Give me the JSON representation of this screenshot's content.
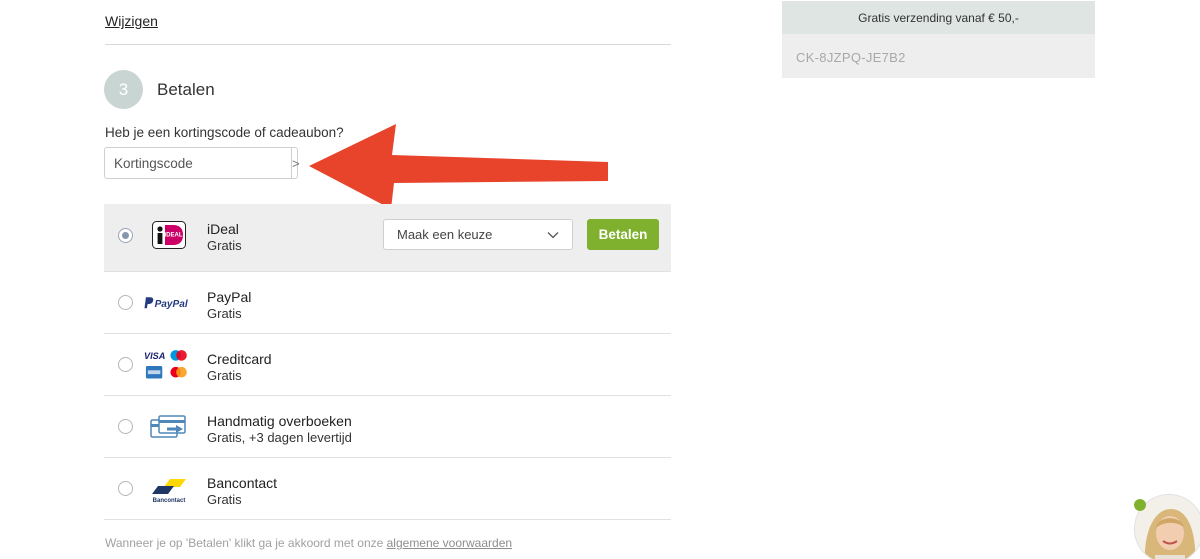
{
  "header": {
    "edit_link": "Wijzigen"
  },
  "step": {
    "number": "3",
    "title": "Betalen"
  },
  "discount": {
    "question": "Heb je een kortingscode of cadeaubon?",
    "placeholder": "Kortingscode",
    "submit_glyph": ">"
  },
  "payment_methods": [
    {
      "name": "iDeal",
      "sub": "Gratis",
      "selected": true,
      "icon": "ideal-logo",
      "bank_select": "Maak een keuze",
      "pay_label": "Betalen"
    },
    {
      "name": "PayPal",
      "sub": "Gratis",
      "selected": false,
      "icon": "paypal-logo",
      "logo_text": "PayPal"
    },
    {
      "name": "Creditcard",
      "sub": "Gratis",
      "selected": false,
      "icon": "creditcard-logos",
      "logo_text": "VISA"
    },
    {
      "name": "Handmatig overboeken",
      "sub": "Gratis, +3 dagen levertijd",
      "selected": false,
      "icon": "bank-transfer-icon"
    },
    {
      "name": "Bancontact",
      "sub": "Gratis",
      "selected": false,
      "icon": "bancontact-logo",
      "logo_text": "Bancontact"
    }
  ],
  "terms": {
    "text": "Wanneer je op 'Betalen' klikt ga je akkoord met onze ",
    "link": "algemene voorwaarden"
  },
  "sidebar": {
    "shipping_note": "Gratis verzending vanaf € 50,-",
    "code": "CK-8JZPQ-JE7B2"
  },
  "colors": {
    "accent_green": "#7fb12e",
    "annotation_red": "#e8432b",
    "step_circle": "#c9d5d3"
  }
}
